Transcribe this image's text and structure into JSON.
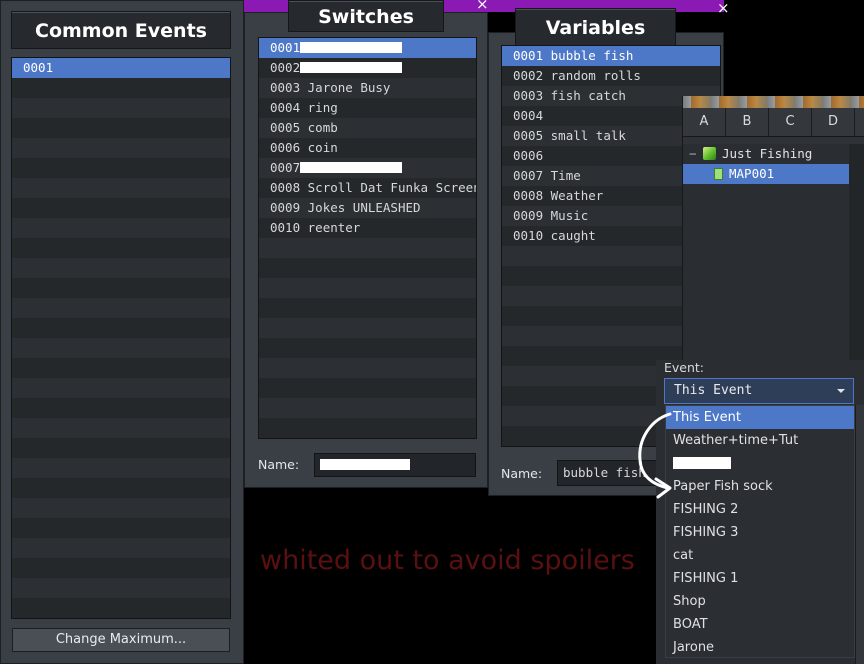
{
  "common_events": {
    "title": "Common Events",
    "items": [
      {
        "id": "0001",
        "name": ""
      }
    ],
    "change_max_label": "Change Maximum..."
  },
  "switches": {
    "title": "Switches",
    "items": [
      {
        "id": "0001",
        "name": "",
        "redacted": true
      },
      {
        "id": "0002",
        "name": "",
        "redacted": true
      },
      {
        "id": "0003",
        "name": "Jarone Busy"
      },
      {
        "id": "0004",
        "name": "ring"
      },
      {
        "id": "0005",
        "name": "comb"
      },
      {
        "id": "0006",
        "name": "coin"
      },
      {
        "id": "0007",
        "name": "",
        "redacted": true
      },
      {
        "id": "0008",
        "name": "Scroll Dat Funka Screen"
      },
      {
        "id": "0009",
        "name": "Jokes UNLEASHED"
      },
      {
        "id": "0010",
        "name": "reenter"
      }
    ],
    "name_label": "Name:",
    "name_value": ""
  },
  "variables": {
    "title": "Variables",
    "items": [
      {
        "id": "0001",
        "name": "bubble fish"
      },
      {
        "id": "0002",
        "name": "random rolls"
      },
      {
        "id": "0003",
        "name": "fish catch"
      },
      {
        "id": "0004",
        "name": ""
      },
      {
        "id": "0005",
        "name": "small talk"
      },
      {
        "id": "0006",
        "name": ""
      },
      {
        "id": "0007",
        "name": "Time"
      },
      {
        "id": "0008",
        "name": "Weather"
      },
      {
        "id": "0009",
        "name": "Music"
      },
      {
        "id": "0010",
        "name": "caught"
      }
    ],
    "name_label": "Name:",
    "name_value": "bubble fish"
  },
  "map_panel": {
    "tabs": [
      "A",
      "B",
      "C",
      "D"
    ],
    "tree": [
      {
        "label": "Just Fishing",
        "expander": "−",
        "icon": "project-cube-icon"
      },
      {
        "label": "MAP001",
        "icon": "map-icon"
      }
    ]
  },
  "event_select": {
    "label": "Event:",
    "value": "This Event",
    "options": [
      {
        "label": "This Event"
      },
      {
        "label": "Weather+time+Tut"
      },
      {
        "label": "",
        "redacted": true
      },
      {
        "label": "Paper Fish sock"
      },
      {
        "label": "FISHING 2"
      },
      {
        "label": "FISHING 3"
      },
      {
        "label": "cat"
      },
      {
        "label": "FISHING 1"
      },
      {
        "label": "Shop"
      },
      {
        "label": "BOAT"
      },
      {
        "label": "Jarone"
      }
    ]
  },
  "annotation": {
    "text": "whited out to avoid spoilers"
  },
  "close_glyph": "×",
  "colors": {
    "selection": "#4d78c7",
    "titlebar": "#8a1ab3",
    "annotation": "#5a1010"
  }
}
